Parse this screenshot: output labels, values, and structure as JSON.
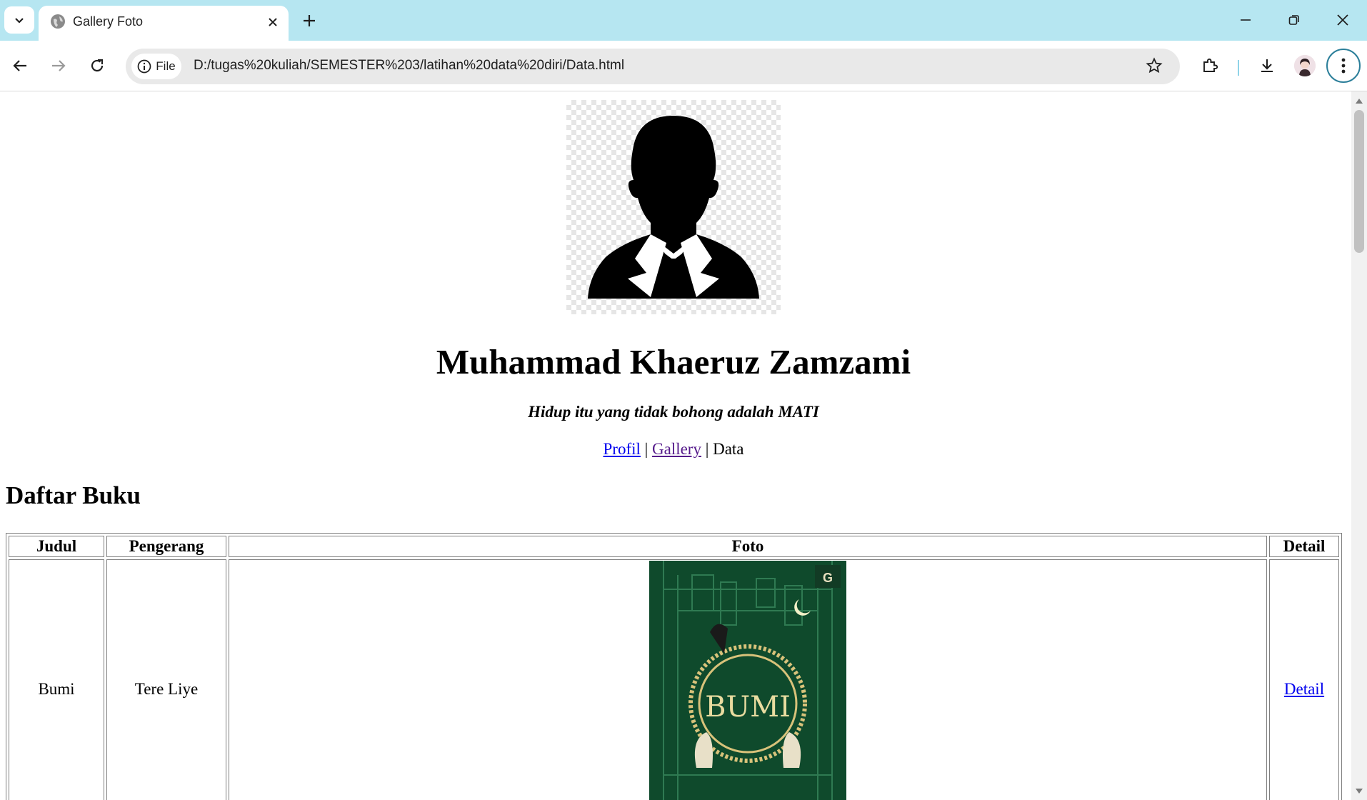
{
  "browser": {
    "tab_title": "Gallery Foto",
    "address_chip": "File",
    "url": "D:/tugas%20kuliah/SEMESTER%203/latihan%20data%20diri/Data.html"
  },
  "page": {
    "name": "Muhammad Khaeruz Zamzami",
    "motto": "Hidup itu yang tidak bohong adalah MATI",
    "nav": {
      "profil": "Profil",
      "sep1": " | ",
      "gallery": "Gallery",
      "sep2": " | ",
      "data": "Data"
    },
    "section_title": "Daftar Buku",
    "table": {
      "headers": [
        "Judul",
        "Pengerang",
        "Foto",
        "Detail"
      ],
      "rows": [
        {
          "judul": "Bumi",
          "pengarang": "Tere Liye",
          "cover_text": "BUMI",
          "cover_badge": "G",
          "detail": "Detail"
        }
      ]
    }
  },
  "colors": {
    "tabstrip": "#b6e6f1",
    "link": "#0000ee",
    "visited_link": "#551a8b",
    "cover_green": "#0f4a2c",
    "cover_gold": "#d8c27a"
  }
}
